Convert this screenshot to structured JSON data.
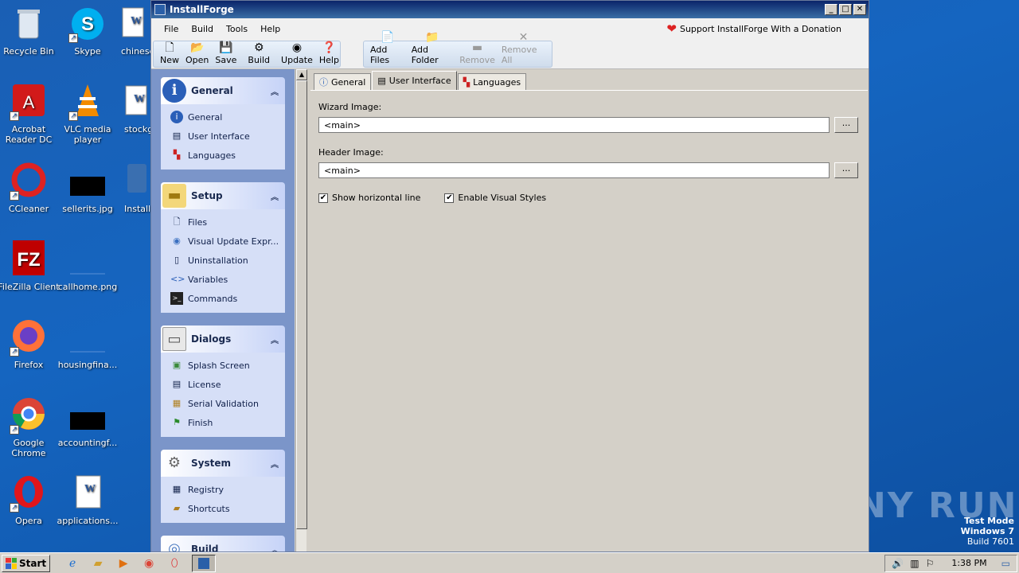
{
  "desktop": {
    "icons": [
      {
        "label": "Recycle Bin"
      },
      {
        "label": "Skype"
      },
      {
        "label": "chinese"
      },
      {
        "label": "Acrobat Reader DC"
      },
      {
        "label": "VLC media player"
      },
      {
        "label": "stockg"
      },
      {
        "label": "CCleaner"
      },
      {
        "label": "sellerits.jpg"
      },
      {
        "label": "Install"
      },
      {
        "label": "FileZilla Client"
      },
      {
        "label": "callhome.png"
      },
      {
        "label": "Firefox"
      },
      {
        "label": "housingfina..."
      },
      {
        "label": "Google Chrome"
      },
      {
        "label": "accountingf..."
      },
      {
        "label": "Opera"
      },
      {
        "label": "applications..."
      }
    ],
    "watermark": "ANY RUN",
    "sysinfo": {
      "line1": "Test Mode",
      "line2": "Windows 7",
      "line3": "Build 7601"
    }
  },
  "window": {
    "title": "InstallForge",
    "controls": {
      "minimize": "_",
      "maximize": "□",
      "close": "✕"
    },
    "menu": [
      "File",
      "Build",
      "Tools",
      "Help"
    ],
    "donate": "Support InstallForge With a Donation",
    "toolbar": {
      "main": [
        {
          "label": "New",
          "icon": "new-icon"
        },
        {
          "label": "Open",
          "icon": "open-icon"
        },
        {
          "label": "Save",
          "icon": "save-icon"
        },
        {
          "label": "Build",
          "icon": "build-icon"
        },
        {
          "label": "Update",
          "icon": "update-icon"
        },
        {
          "label": "Help",
          "icon": "help-icon"
        }
      ],
      "files": [
        {
          "label": "Add Files",
          "enabled": true
        },
        {
          "label": "Add Folder",
          "enabled": true
        },
        {
          "label": "Remove",
          "enabled": false
        },
        {
          "label": "Remove All",
          "enabled": false
        }
      ]
    },
    "sidebar": {
      "sections": [
        {
          "title": "General",
          "items": [
            "General",
            "User Interface",
            "Languages"
          ]
        },
        {
          "title": "Setup",
          "items": [
            "Files",
            "Visual Update Expr...",
            "Uninstallation",
            "Variables",
            "Commands"
          ]
        },
        {
          "title": "Dialogs",
          "items": [
            "Splash Screen",
            "License",
            "Serial Validation",
            "Finish"
          ]
        },
        {
          "title": "System",
          "items": [
            "Registry",
            "Shortcuts"
          ]
        },
        {
          "title": "Build",
          "items": []
        }
      ]
    },
    "tabs": [
      "General",
      "User Interface",
      "Languages"
    ],
    "active_tab": "User Interface",
    "form": {
      "wizard_image_label": "Wizard Image:",
      "wizard_image_value": "<main>",
      "header_image_label": "Header Image:",
      "header_image_value": "<main>",
      "browse_label": "...",
      "show_horizontal_line": "Show horizontal line",
      "enable_visual_styles": "Enable Visual Styles"
    }
  },
  "taskbar": {
    "start": "Start",
    "clock": "1:38 PM"
  }
}
